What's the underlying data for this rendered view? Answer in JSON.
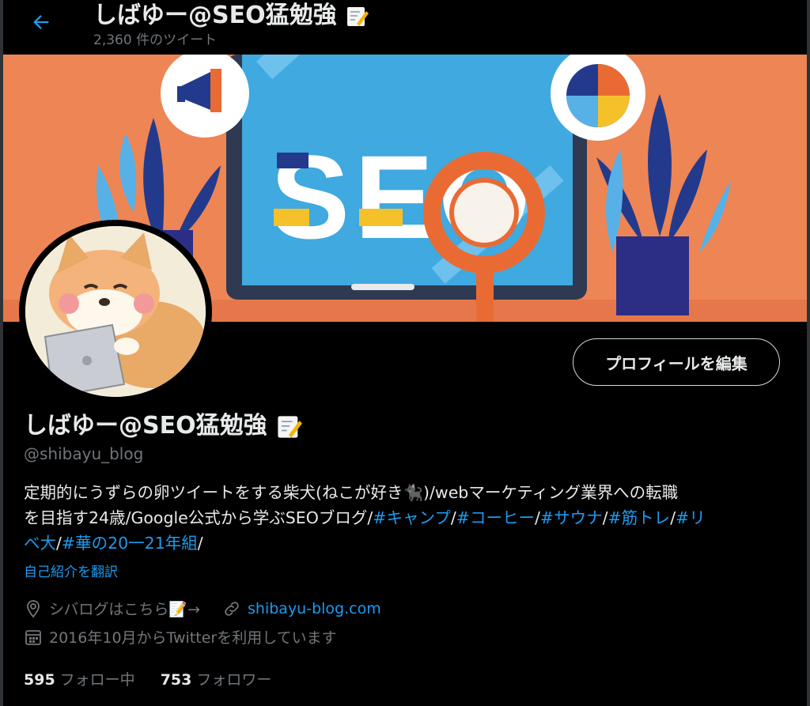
{
  "header": {
    "title": "しばゆー@SEO猛勉強",
    "tweet_count": "2,360 件のツイート"
  },
  "banner": {
    "text": "SEO"
  },
  "profile": {
    "name": "しばゆー@SEO猛勉強",
    "handle": "@shibayu_blog",
    "edit_button": "プロフィールを編集",
    "bio": {
      "line1": "定期的にうずらの卵ツイートをする柴犬(ねこが好き🐈‍⬛)/webマーケティング業界への転職",
      "line2_text": "を目指す24歳/Google公式から学ぶSEOブログ/",
      "tags": [
        "#キャンプ",
        "#コーヒー",
        "#サウナ",
        "#筋トレ",
        "#リベ大",
        "#華の20一21年組"
      ],
      "sep": "/",
      "tag_riba_part1": "#リ",
      "tag_riba_part2": "ベ大"
    },
    "translate": "自己紹介を翻訳",
    "location": "シバログはこちら📝→",
    "website": "shibayu-blog.com",
    "joined": "2016年10月からTwitterを利用しています",
    "following_count": "595",
    "following_label": "フォロー中",
    "followers_count": "753",
    "followers_label": "フォロワー"
  },
  "colors": {
    "accent": "#1d9bf0",
    "banner_bg": "#ee8555",
    "screen": "#3fa9e0"
  }
}
